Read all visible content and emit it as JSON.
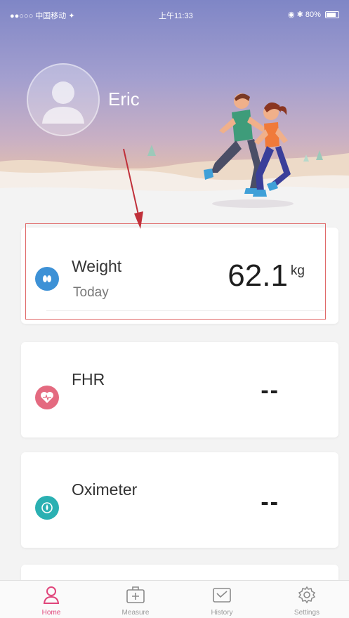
{
  "status_bar": {
    "carrier": "●●○○○ 中国移动 ✦",
    "time": "上午11:33",
    "right": "◉ ✱ 80%"
  },
  "profile": {
    "name": "Eric"
  },
  "cards": [
    {
      "title": "Weight",
      "subtitle": "Today",
      "value": "62.1",
      "unit": "kg",
      "icon": "footprint-icon",
      "color": "#3d91d6"
    },
    {
      "title": "FHR",
      "value": "--",
      "icon": "heart-icon",
      "color": "#e46a80"
    },
    {
      "title": "Oximeter",
      "value": "--",
      "icon": "oximeter-icon",
      "color": "#2ab0b2"
    }
  ],
  "tabbar": {
    "items": [
      {
        "label": "Home",
        "icon": "person-icon",
        "active": true
      },
      {
        "label": "Measure",
        "icon": "medical-kit-icon",
        "active": false
      },
      {
        "label": "History",
        "icon": "history-icon",
        "active": false
      },
      {
        "label": "Settings",
        "icon": "gear-icon",
        "active": false
      }
    ]
  },
  "colors": {
    "accent": "#e0447a",
    "highlight_box": "#e06a6a",
    "annotation_arrow": "#c0303a"
  }
}
